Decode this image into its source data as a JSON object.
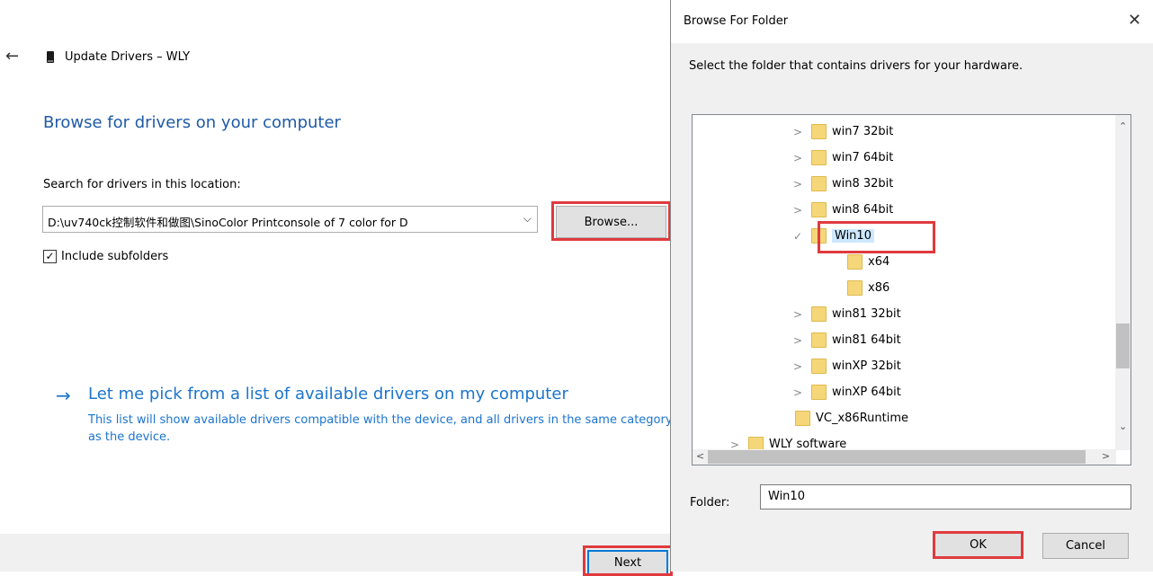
{
  "wizard": {
    "title": "Update Drivers – WLY",
    "back_icon": "back-arrow-icon",
    "heading": "Browse for drivers on your computer",
    "search_label": "Search for drivers in this location:",
    "path_value": "D:\\uv740ck控制软件和做图\\SinoColor Printconsole of 7 color for D",
    "browse_label": "Browse...",
    "include_subfolders_label": "Include subfolders",
    "include_subfolders_checked": true,
    "pick_link_text": "Let me pick from a list of available drivers on my computer",
    "pick_link_desc": "This list will show available drivers compatible with the device, and all drivers in the same category as the device.",
    "next_label": "Next"
  },
  "dialog": {
    "title": "Browse For Folder",
    "close_icon": "close-icon",
    "description": "Select the folder that contains drivers for your hardware.",
    "tree_items": [
      {
        "label": "win7 32bit",
        "level": 2,
        "expand": ">"
      },
      {
        "label": "win7 64bit",
        "level": 2,
        "expand": ">"
      },
      {
        "label": "win8 32bit",
        "level": 2,
        "expand": ">"
      },
      {
        "label": "win8 64bit",
        "level": 2,
        "expand": ">"
      },
      {
        "label": "Win10",
        "level": 2,
        "expand": "✓",
        "selected": true
      },
      {
        "label": "x64",
        "level": 3,
        "expand": ""
      },
      {
        "label": "x86",
        "level": 3,
        "expand": ""
      },
      {
        "label": "win81 32bit",
        "level": 2,
        "expand": ">"
      },
      {
        "label": "win81 64bit",
        "level": 2,
        "expand": ">"
      },
      {
        "label": "winXP 32bit",
        "level": 2,
        "expand": ">"
      },
      {
        "label": "winXP 64bit",
        "level": 2,
        "expand": ">"
      },
      {
        "label": "VC_x86Runtime",
        "level": 1,
        "expand": ""
      },
      {
        "label": "WLY software",
        "level": 0,
        "expand": ">"
      }
    ],
    "folder_label": "Folder:",
    "folder_value": "Win10",
    "ok_label": "OK",
    "cancel_label": "Cancel"
  },
  "colors": {
    "heading_blue": "#1f5aa6",
    "link_blue": "#1c74cc",
    "highlight_red": "#e03a3e",
    "selection_blue": "#cce8ff",
    "folder_yellow": "#f5d77a"
  }
}
